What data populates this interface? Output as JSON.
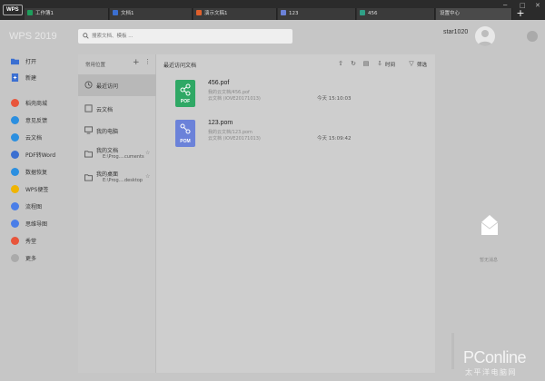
{
  "titlebar": {
    "logo": "WPS",
    "tabs": [
      {
        "label": "工作簿1",
        "color": "#1e9e5c"
      },
      {
        "label": "文档1",
        "color": "#3b6fd1"
      },
      {
        "label": "演示文稿1",
        "color": "#e0602c"
      },
      {
        "label": "123",
        "color": "#6b82d9"
      },
      {
        "label": "456",
        "color": "#2f9f86"
      },
      {
        "label": "设置中心",
        "color": ""
      }
    ],
    "new_tab": "+",
    "window_buttons": [
      "─",
      "□",
      "✕"
    ]
  },
  "header": {
    "app_name": "WPS 2019",
    "search_placeholder": "搜索文档、模板 ...",
    "username": "star1020"
  },
  "sidebar": {
    "items": [
      {
        "label": "打开",
        "color": "#3b6fd1",
        "icon": "folder-icon"
      },
      {
        "label": "新建",
        "color": "#3b6fd1",
        "icon": "new-file-icon"
      },
      {
        "label": "稻壳商城",
        "color": "#e8553b",
        "icon": "shop-icon"
      },
      {
        "label": "意见反馈",
        "color": "#2b8fe0",
        "icon": "feedback-icon"
      },
      {
        "label": "云文档",
        "color": "#2b8fe0",
        "icon": "cloud-icon"
      },
      {
        "label": "PDF转Word",
        "color": "#3b6fd1",
        "icon": "pdf-icon"
      },
      {
        "label": "数据恢复",
        "color": "#2b8fe0",
        "icon": "restore-icon"
      },
      {
        "label": "WPS便签",
        "color": "#f0b400",
        "icon": "note-icon"
      },
      {
        "label": "流程图",
        "color": "#4a7ee8",
        "icon": "flowchart-icon"
      },
      {
        "label": "思维导图",
        "color": "#4a7ee8",
        "icon": "mindmap-icon"
      },
      {
        "label": "秀堂",
        "color": "#e8553b",
        "icon": "show-icon"
      },
      {
        "label": "更多",
        "color": "#aaaaaa",
        "icon": "more-icon"
      }
    ]
  },
  "nav": {
    "title": "常用位置",
    "plus": "+",
    "more": "⋮",
    "items": [
      {
        "label": "最近访问",
        "icon": "clock-icon"
      },
      {
        "label": "云文档",
        "icon": "cloud-doc-icon"
      },
      {
        "label": "我的电脑",
        "icon": "computer-icon"
      },
      {
        "label": "我的文档",
        "path": "E:\\Prog....cuments",
        "icon": "document-folder-icon"
      },
      {
        "label": "我的桌面",
        "path": "E:\\Prog....desktop",
        "icon": "desktop-folder-icon"
      }
    ]
  },
  "content": {
    "title": "最近访问文档",
    "sort_label": "时间",
    "filter_label": "筛选",
    "files": [
      {
        "name": "456.pof",
        "ext": "POF",
        "color": "#2fa865",
        "path": "我的云文档/456.pof",
        "owner": "云文档 (IOVE20171013)",
        "time": "今天 15:10:03"
      },
      {
        "name": "123.pom",
        "ext": "POM",
        "color": "#6b82d9",
        "path": "我的云文档/123.pom",
        "owner": "云文档 (IOVE20171013)",
        "time": "今天 15:09:42"
      }
    ]
  },
  "rightpanel": {
    "text": "暂无消息"
  },
  "watermark": {
    "title": "PConline",
    "subtitle": "太平洋电脑网"
  }
}
